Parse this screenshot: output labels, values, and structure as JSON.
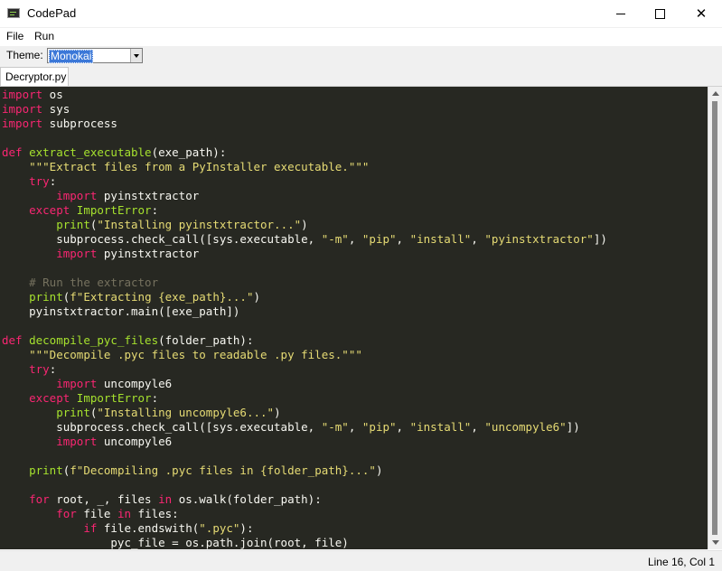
{
  "window": {
    "title": "CodePad",
    "icon": "terminal-app-icon"
  },
  "menu": {
    "items": [
      "File",
      "Run"
    ]
  },
  "toolbar": {
    "theme_label": "Theme:",
    "theme_value": "Monokai"
  },
  "tabs": [
    {
      "label": "Decryptor.py",
      "active": true
    }
  ],
  "status": {
    "position": "Line 16, Col 1"
  },
  "colors": {
    "editor_bg": "#272822",
    "keyword": "#f92672",
    "function": "#a6e22e",
    "string": "#e6db74",
    "comment": "#75715e",
    "text": "#f8f8f2"
  },
  "code_lines": [
    [
      [
        "kw",
        "import"
      ],
      [
        "t",
        " os"
      ]
    ],
    [
      [
        "kw",
        "import"
      ],
      [
        "t",
        " sys"
      ]
    ],
    [
      [
        "kw",
        "import"
      ],
      [
        "t",
        " subprocess"
      ]
    ],
    [],
    [
      [
        "kw",
        "def"
      ],
      [
        "t",
        " "
      ],
      [
        "fn",
        "extract_executable"
      ],
      [
        "t",
        "(exe_path):"
      ]
    ],
    [
      [
        "t",
        "    "
      ],
      [
        "st",
        "\"\"\"Extract files from a PyInstaller executable.\"\"\""
      ]
    ],
    [
      [
        "t",
        "    "
      ],
      [
        "kw",
        "try"
      ],
      [
        "t",
        ":"
      ]
    ],
    [
      [
        "t",
        "        "
      ],
      [
        "kw",
        "import"
      ],
      [
        "t",
        " pyinstxtractor"
      ]
    ],
    [
      [
        "t",
        "    "
      ],
      [
        "kw",
        "except"
      ],
      [
        "t",
        " "
      ],
      [
        "ex",
        "ImportError"
      ],
      [
        "t",
        ":"
      ]
    ],
    [
      [
        "t",
        "        "
      ],
      [
        "ex",
        "print"
      ],
      [
        "t",
        "("
      ],
      [
        "st",
        "\"Installing pyinstxtractor...\""
      ],
      [
        "t",
        ")"
      ]
    ],
    [
      [
        "t",
        "        subprocess.check_call([sys.executable, "
      ],
      [
        "st",
        "\"-m\""
      ],
      [
        "t",
        ", "
      ],
      [
        "st",
        "\"pip\""
      ],
      [
        "t",
        ", "
      ],
      [
        "st",
        "\"install\""
      ],
      [
        "t",
        ", "
      ],
      [
        "st",
        "\"pyinstxtractor\""
      ],
      [
        "t",
        "])"
      ]
    ],
    [
      [
        "t",
        "        "
      ],
      [
        "kw",
        "import"
      ],
      [
        "t",
        " pyinstxtractor"
      ]
    ],
    [],
    [
      [
        "t",
        "    "
      ],
      [
        "cm",
        "# Run the extractor"
      ]
    ],
    [
      [
        "t",
        "    "
      ],
      [
        "ex",
        "print"
      ],
      [
        "t",
        "("
      ],
      [
        "st",
        "f\"Extracting {exe_path}...\""
      ],
      [
        "t",
        ")"
      ]
    ],
    [
      [
        "t",
        "    pyinstxtractor.main([exe_path])"
      ]
    ],
    [],
    [
      [
        "kw",
        "def"
      ],
      [
        "t",
        " "
      ],
      [
        "fn",
        "decompile_pyc_files"
      ],
      [
        "t",
        "(folder_path):"
      ]
    ],
    [
      [
        "t",
        "    "
      ],
      [
        "st",
        "\"\"\"Decompile .pyc files to readable .py files.\"\"\""
      ]
    ],
    [
      [
        "t",
        "    "
      ],
      [
        "kw",
        "try"
      ],
      [
        "t",
        ":"
      ]
    ],
    [
      [
        "t",
        "        "
      ],
      [
        "kw",
        "import"
      ],
      [
        "t",
        " uncompyle6"
      ]
    ],
    [
      [
        "t",
        "    "
      ],
      [
        "kw",
        "except"
      ],
      [
        "t",
        " "
      ],
      [
        "ex",
        "ImportError"
      ],
      [
        "t",
        ":"
      ]
    ],
    [
      [
        "t",
        "        "
      ],
      [
        "ex",
        "print"
      ],
      [
        "t",
        "("
      ],
      [
        "st",
        "\"Installing uncompyle6...\""
      ],
      [
        "t",
        ")"
      ]
    ],
    [
      [
        "t",
        "        subprocess.check_call([sys.executable, "
      ],
      [
        "st",
        "\"-m\""
      ],
      [
        "t",
        ", "
      ],
      [
        "st",
        "\"pip\""
      ],
      [
        "t",
        ", "
      ],
      [
        "st",
        "\"install\""
      ],
      [
        "t",
        ", "
      ],
      [
        "st",
        "\"uncompyle6\""
      ],
      [
        "t",
        "])"
      ]
    ],
    [
      [
        "t",
        "        "
      ],
      [
        "kw",
        "import"
      ],
      [
        "t",
        " uncompyle6"
      ]
    ],
    [],
    [
      [
        "t",
        "    "
      ],
      [
        "ex",
        "print"
      ],
      [
        "t",
        "("
      ],
      [
        "st",
        "f\"Decompiling .pyc files in {folder_path}...\""
      ],
      [
        "t",
        ")"
      ]
    ],
    [],
    [
      [
        "t",
        "    "
      ],
      [
        "kw",
        "for"
      ],
      [
        "t",
        " root, _, files "
      ],
      [
        "kw",
        "in"
      ],
      [
        "t",
        " os.walk(folder_path):"
      ]
    ],
    [
      [
        "t",
        "        "
      ],
      [
        "kw",
        "for"
      ],
      [
        "t",
        " file "
      ],
      [
        "kw",
        "in"
      ],
      [
        "t",
        " files:"
      ]
    ],
    [
      [
        "t",
        "            "
      ],
      [
        "kw",
        "if"
      ],
      [
        "t",
        " file.endswith("
      ],
      [
        "st",
        "\".pyc\""
      ],
      [
        "t",
        "):"
      ]
    ],
    [
      [
        "t",
        "                pyc_file = os.path.join(root, file)"
      ]
    ]
  ]
}
